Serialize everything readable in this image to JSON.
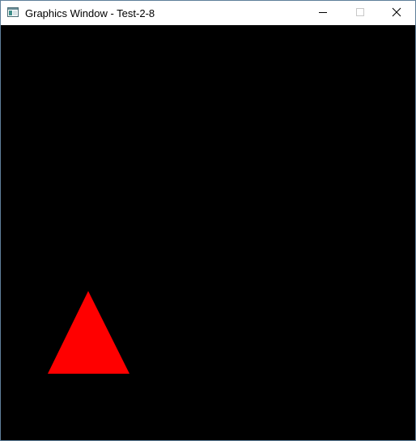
{
  "window": {
    "title": "Graphics Window - Test-2-8",
    "icon": "app-window-icon",
    "controls": {
      "minimize_icon": "minimize-icon",
      "maximize_icon": "maximize-icon",
      "close_icon": "close-icon"
    }
  },
  "canvas": {
    "background_color": "#000000",
    "shapes": [
      {
        "type": "triangle",
        "fill": "#ff0000"
      }
    ]
  }
}
